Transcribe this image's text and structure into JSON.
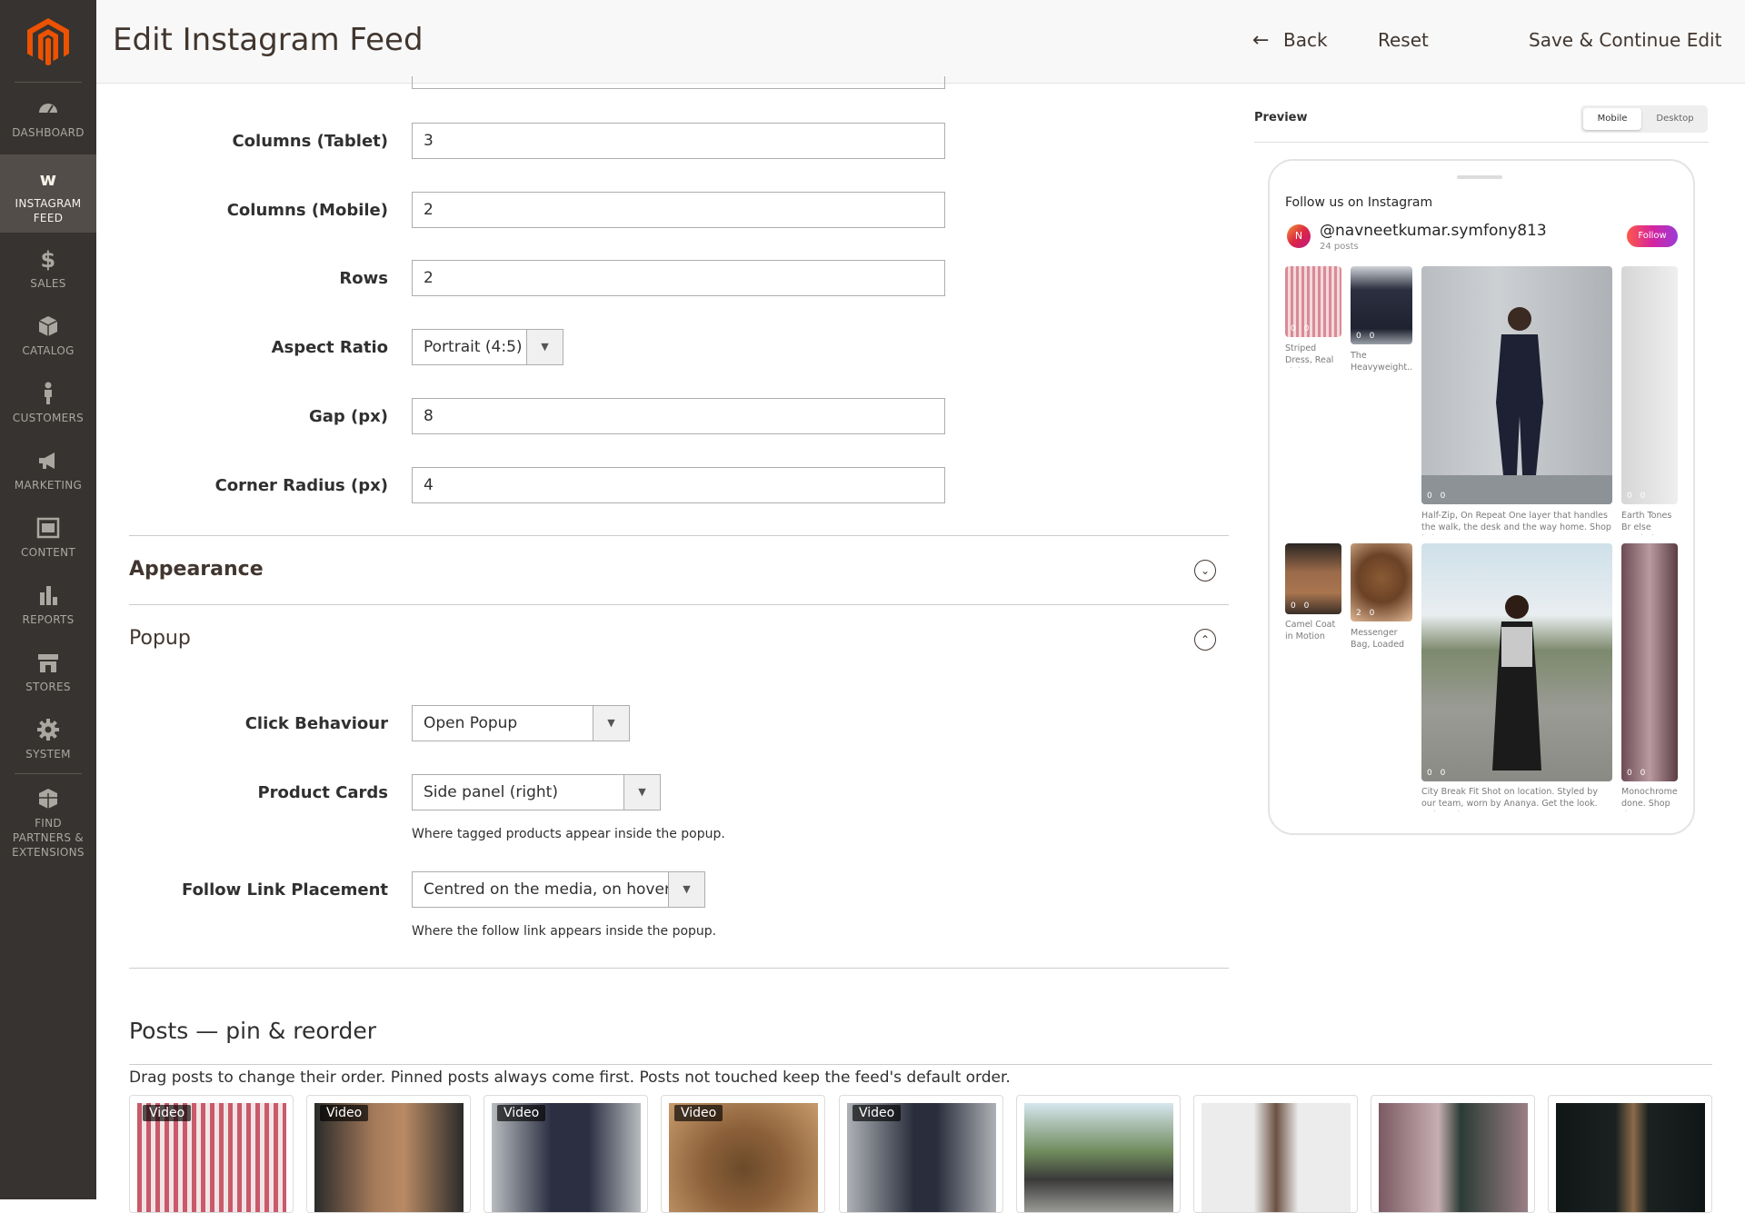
{
  "header": {
    "title": "Edit Instagram Feed",
    "back_label": "Back",
    "reset_label": "Reset",
    "save_label": "Save & Continue Edit"
  },
  "sidebar": {
    "items": [
      {
        "label": "DASHBOARD"
      },
      {
        "label": "INSTAGRAM FEED"
      },
      {
        "label": "SALES"
      },
      {
        "label": "CATALOG"
      },
      {
        "label": "CUSTOMERS"
      },
      {
        "label": "MARKETING"
      },
      {
        "label": "CONTENT"
      },
      {
        "label": "REPORTS"
      },
      {
        "label": "STORES"
      },
      {
        "label": "SYSTEM"
      },
      {
        "label": "FIND PARTNERS & EXTENSIONS"
      }
    ]
  },
  "layout_fields": {
    "columns_tablet": {
      "label": "Columns (Tablet)",
      "value": "3"
    },
    "columns_mobile": {
      "label": "Columns (Mobile)",
      "value": "2"
    },
    "rows": {
      "label": "Rows",
      "value": "2"
    },
    "aspect_ratio": {
      "label": "Aspect Ratio",
      "value": "Portrait (4:5)"
    },
    "gap": {
      "label": "Gap (px)",
      "value": "8"
    },
    "corner_radius": {
      "label": "Corner Radius (px)",
      "value": "4"
    }
  },
  "sections": {
    "appearance": "Appearance",
    "popup": "Popup"
  },
  "popup_fields": {
    "click_behaviour": {
      "label": "Click Behaviour",
      "value": "Open Popup"
    },
    "product_cards": {
      "label": "Product Cards",
      "value": "Side panel (right)",
      "hint": "Where tagged products appear inside the popup."
    },
    "follow_link": {
      "label": "Follow Link Placement",
      "value": "Centred on the media, on hover",
      "hint": "Where the follow link appears inside the popup."
    }
  },
  "preview": {
    "label": "Preview",
    "mobile_label": "Mobile",
    "desktop_label": "Desktop",
    "follow_us": "Follow us on Instagram",
    "avatar_letter": "N",
    "handle": "@navneetkumar.symfony813",
    "post_count": "24 posts",
    "follow_button": "Follow",
    "stats": "0 0",
    "stats_bag": "2 0",
    "captions": {
      "c1": "Striped Dress, Real Light N...",
      "c2": "The Heavyweight...",
      "c3": "Half-Zip, On Repeat One layer that handles the walk, the desk and the way home. Shop knitwe...",
      "c4": "Earth Tones Br else needed. L",
      "c5": "Camel Coat in Motion See...",
      "c6": "Messenger Bag, Loaded Lapto...",
      "c7": "City Break Fit Shot on location. Styled by our team, worn by Ananya. Get the look. #citystyle...",
      "c8": "Monochrome done. Shop th"
    }
  },
  "posts": {
    "title": "Posts — pin & reorder",
    "description": "Drag posts to change their order. Pinned posts always come first. Posts not touched keep the feed's default order.",
    "badge": "Video"
  },
  "colors": {
    "sidebar_bg": "#373330",
    "sidebar_active": "#524d49",
    "brand_orange": "#eb5202",
    "instagram_gradient": "#d6249f"
  }
}
